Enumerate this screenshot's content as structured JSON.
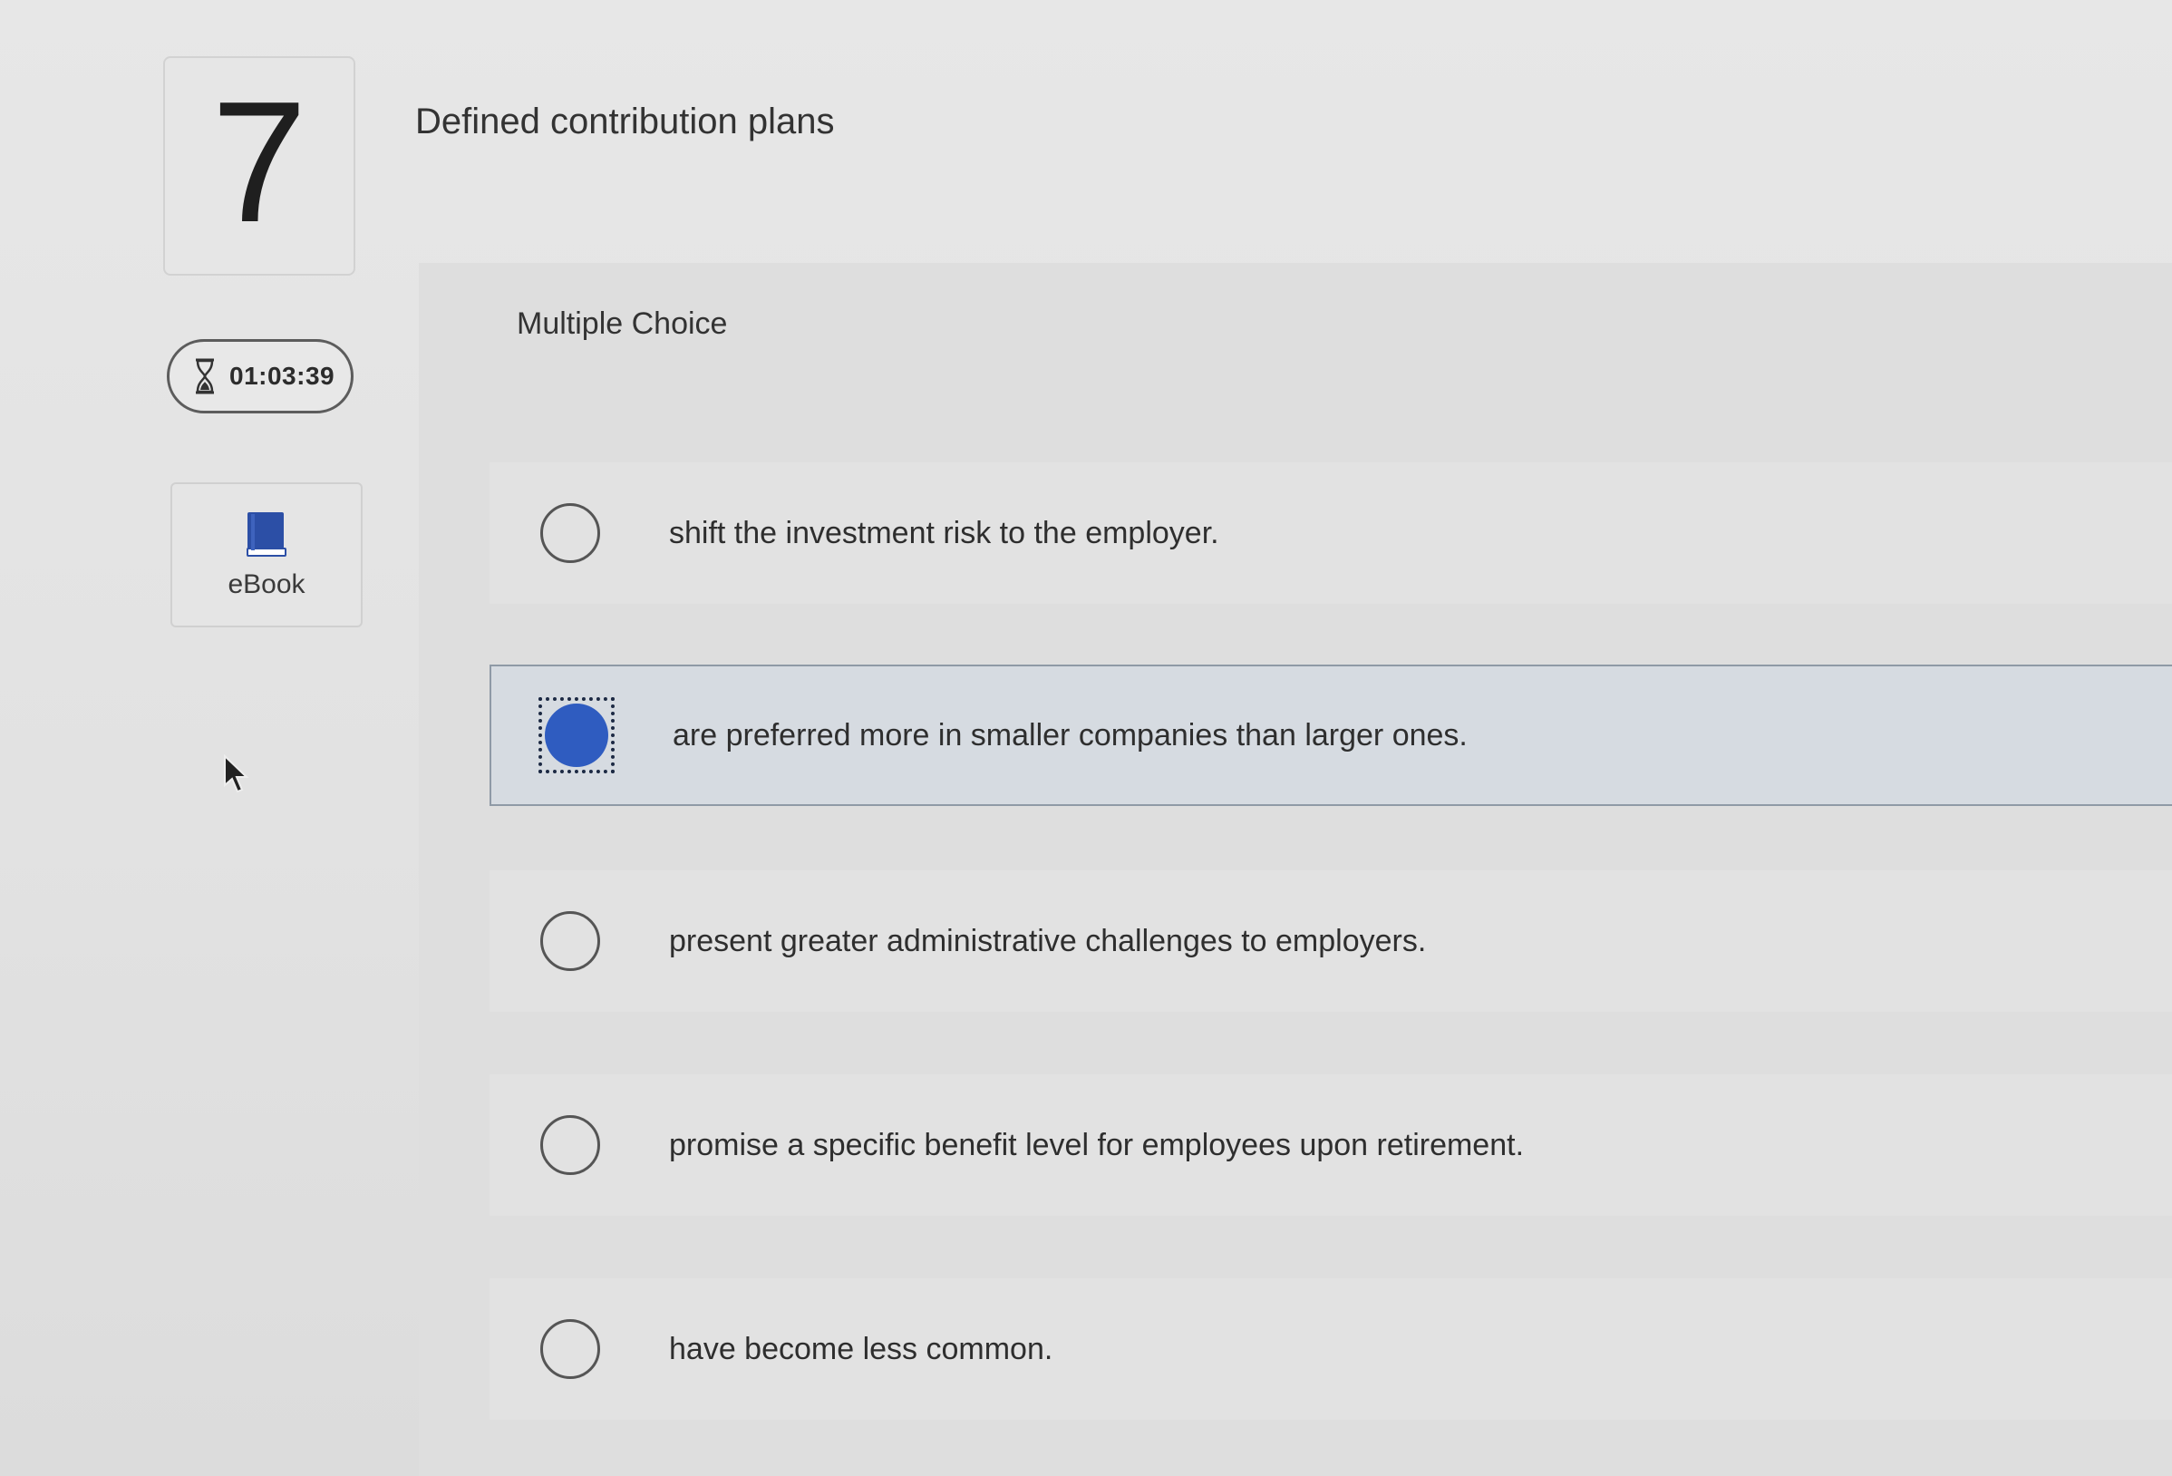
{
  "question": {
    "number": "7",
    "title": "Defined contribution plans",
    "type_label": "Multiple Choice"
  },
  "timer": {
    "icon": "hourglass-icon",
    "value": "01:03:39"
  },
  "ebook": {
    "icon": "book-icon",
    "label": "eBook"
  },
  "options": [
    {
      "text": "shift the investment risk to the employer.",
      "selected": false
    },
    {
      "text": "are preferred more in smaller companies than larger ones.",
      "selected": true
    },
    {
      "text": "present greater administrative challenges to employers.",
      "selected": false
    },
    {
      "text": "promise a specific benefit level for employees upon retirement.",
      "selected": false
    },
    {
      "text": "have become less common.",
      "selected": false
    }
  ],
  "colors": {
    "selected_radio": "#2f5cc0",
    "selected_row": "#d6dbe1",
    "background": "#e4e4e4"
  }
}
